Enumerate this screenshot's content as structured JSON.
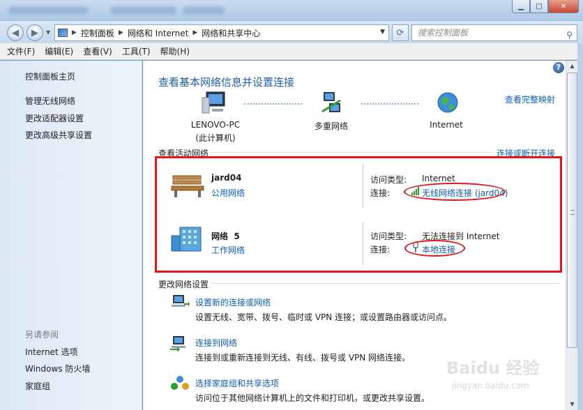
{
  "window": {
    "buttons": {
      "minimize": "▁",
      "maximize": "□",
      "close": "✕"
    }
  },
  "nav": {
    "back_icon": "back-arrow-icon",
    "forward_icon": "forward-arrow-icon",
    "breadcrumb": [
      "控制面板",
      "网络和 Internet",
      "网络和共享中心"
    ],
    "search_placeholder": "搜索控制面板"
  },
  "menu": [
    "文件(F)",
    "编辑(E)",
    "查看(V)",
    "工具(T)",
    "帮助(H)"
  ],
  "sidebar": {
    "main_link": "控制面板主页",
    "links": [
      "管理无线网络",
      "更改适配器设置",
      "更改高级共享设置"
    ],
    "see_also_title": "另请参阅",
    "see_also": [
      "Internet 选项",
      "Windows 防火墙",
      "家庭组"
    ]
  },
  "main": {
    "title": "查看基本网络信息并设置连接",
    "full_map_link": "查看完整映射",
    "map": {
      "pc_name": "LENOVO-PC",
      "pc_sub": "(此计算机)",
      "mid": "多重网络",
      "internet": "Internet"
    },
    "active_title": "查看活动网络",
    "connect_disconnect": "连接或断开连接",
    "networks": [
      {
        "name": "jard04",
        "category": "公用网络",
        "access_label": "访问类型:",
        "access_value": "Internet",
        "conn_label": "连接:",
        "conn_value": "无线网络连接 (jard04)"
      },
      {
        "name": "网络  5",
        "category": "工作网络",
        "access_label": "访问类型:",
        "access_value": "无法连接到 Internet",
        "conn_label": "连接:",
        "conn_value": "本地连接"
      }
    ],
    "change_title": "更改网络设置",
    "tasks": [
      {
        "link": "设置新的连接或网络",
        "desc": "设置无线、宽带、拨号、临时或 VPN 连接；或设置路由器或访问点。"
      },
      {
        "link": "连接到网络",
        "desc": "连接到或重新连接到无线、有线、拨号或 VPN 网络连接。"
      },
      {
        "link": "选择家庭组和共享选项",
        "desc": "访问位于其他网络计算机上的文件和打印机，或更改共享设置。"
      }
    ]
  },
  "watermark": {
    "brand": "Baidu 经验",
    "url": "jingyan.baidu.com"
  }
}
